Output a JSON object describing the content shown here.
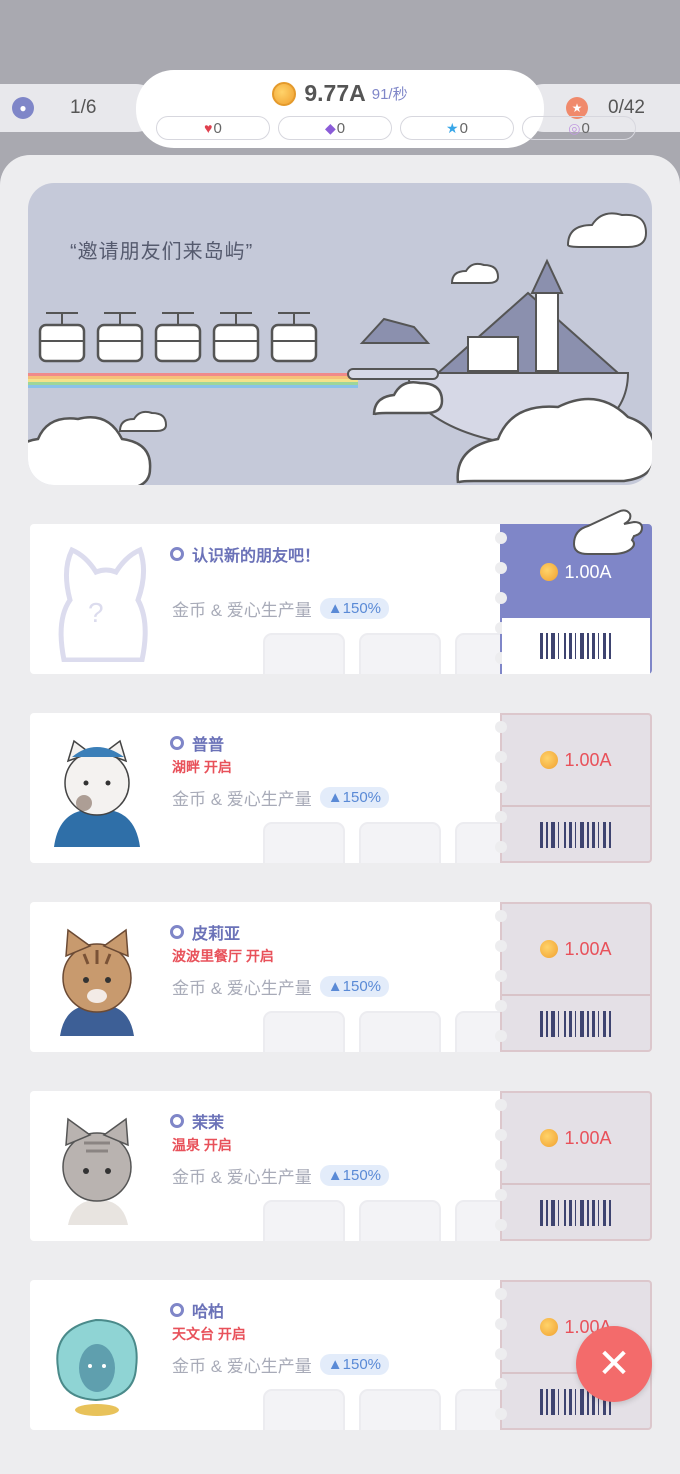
{
  "top_bar": {
    "friends_count": "1/6",
    "stars_count": "0/42",
    "coins": "9.77A",
    "coin_rate": "91/秒",
    "resources": [
      {
        "icon": "heart-icon",
        "value": "0"
      },
      {
        "icon": "gem-icon",
        "value": "0"
      },
      {
        "icon": "star-gem-icon",
        "value": "0"
      },
      {
        "icon": "orb-icon",
        "value": "0"
      }
    ]
  },
  "banner": {
    "quote": "“邀请朋友们来岛屿”"
  },
  "cards": [
    {
      "name": "认识新的朋友吧！",
      "unlock": "",
      "production": "金币 & 爱心生产量",
      "boost": "▲150%",
      "price": "1.00A",
      "active": true,
      "avatar": "unknown-cat"
    },
    {
      "name": "普普",
      "unlock": "湖畔 开启",
      "production": "金币 & 爱心生产量",
      "boost": "▲150%",
      "price": "1.00A",
      "active": false,
      "avatar": "white-cat"
    },
    {
      "name": "皮莉亚",
      "unlock": "波波里餐厅 开启",
      "production": "金币 & 爱心生产量",
      "boost": "▲150%",
      "price": "1.00A",
      "active": false,
      "avatar": "tabby-cat"
    },
    {
      "name": "茉茉",
      "unlock": "温泉 开启",
      "production": "金币 & 爱心生产量",
      "boost": "▲150%",
      "price": "1.00A",
      "active": false,
      "avatar": "gray-cat"
    },
    {
      "name": "哈柏",
      "unlock": "天文台 开启",
      "production": "金币 & 爱心生产量",
      "boost": "▲150%",
      "price": "1.00A",
      "active": false,
      "avatar": "teal-creature"
    }
  ],
  "colors": {
    "accent": "#7f86c8",
    "unlock_red": "#e8515a",
    "close_button": "#f36b6b"
  }
}
